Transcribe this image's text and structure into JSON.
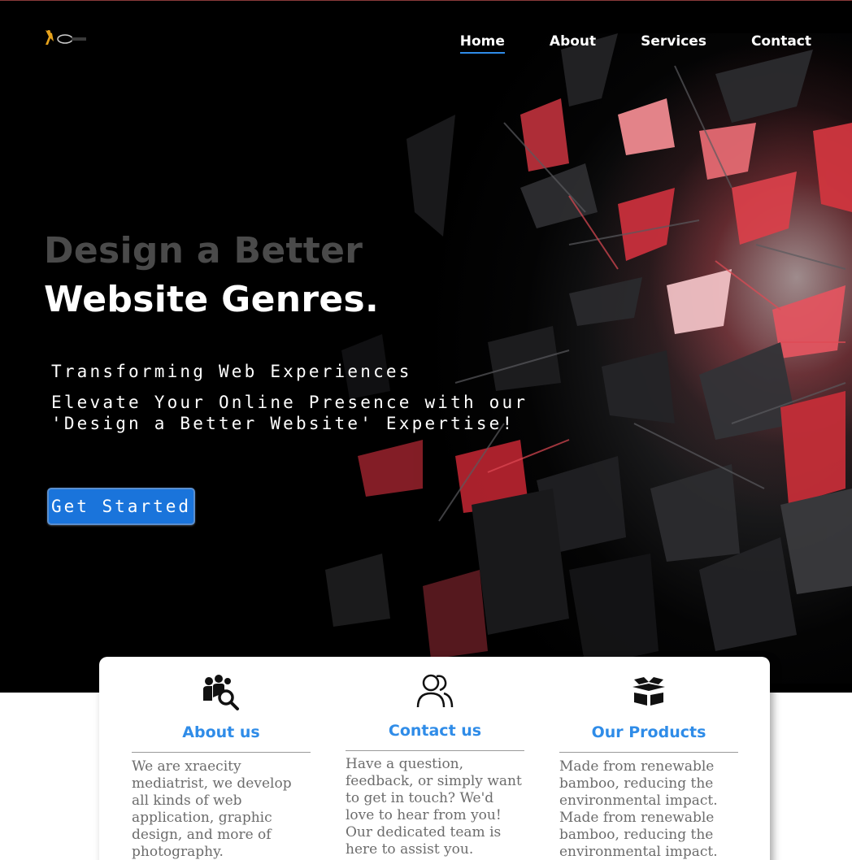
{
  "nav": {
    "items": [
      {
        "label": "Home",
        "active": true
      },
      {
        "label": "About",
        "active": false
      },
      {
        "label": "Services",
        "active": false
      },
      {
        "label": "Contact",
        "active": false
      }
    ]
  },
  "hero": {
    "headline_line1": "Design a Better",
    "headline_line2": "Website Genres.",
    "tagline": "Transforming Web Experiences",
    "subtext": "Elevate Your Online Presence with our 'Design a Better Website' Expertise!",
    "cta_label": "Get Started"
  },
  "cards": [
    {
      "icon": "team-search-icon",
      "title": "About us",
      "text": "We are xraecity mediatrist, we develop all kinds of web application, graphic design, and more of photography."
    },
    {
      "icon": "users-icon",
      "title": "Contact us",
      "text": "Have a question, feedback, or simply want to get in touch? We'd love to hear from you! Our dedicated team is here to assist you."
    },
    {
      "icon": "open-box-icon",
      "title": "Our Products",
      "text": "Made from renewable bamboo, reducing the environmental impact. Made from renewable bamboo, reducing the environmental impact."
    }
  ],
  "colors": {
    "accent": "#2f8ce8",
    "cta": "#1a74db",
    "hero_bg": "#000000",
    "hero_red": "#e03a44"
  }
}
